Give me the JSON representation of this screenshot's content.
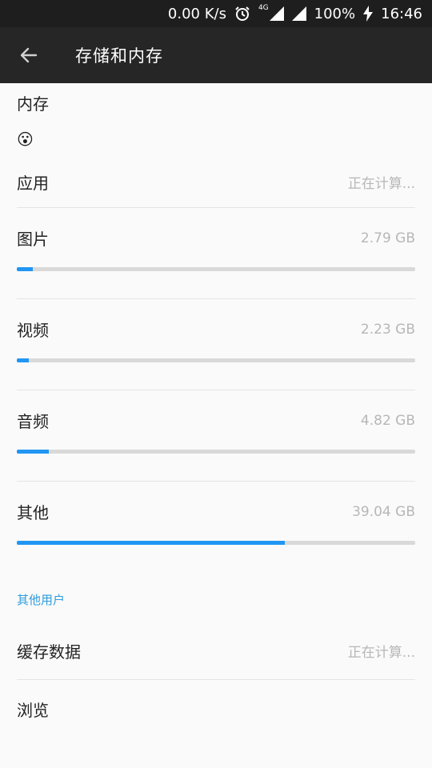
{
  "status": {
    "net_speed": "0.00 K/s",
    "alarm_icon": "alarm-icon",
    "network": "4G",
    "battery": "100%",
    "time": "16:46"
  },
  "appbar": {
    "title": "存储和内存"
  },
  "memory": {
    "section_title": "内存",
    "emoji": "😮"
  },
  "apps": {
    "label": "应用",
    "value": "正在计算..."
  },
  "categories": [
    {
      "label": "图片",
      "value": "2.79 GB",
      "fraction": 0.04
    },
    {
      "label": "视频",
      "value": "2.23 GB",
      "fraction": 0.03
    },
    {
      "label": "音频",
      "value": "4.82 GB",
      "fraction": 0.08
    },
    {
      "label": "其他",
      "value": "39.04 GB",
      "fraction": 0.672
    }
  ],
  "other_users": {
    "header": "其他用户"
  },
  "cache": {
    "label": "缓存数据",
    "value": "正在计算..."
  },
  "browse": {
    "label": "浏览"
  },
  "colors": {
    "accent": "#2196f3",
    "subheader": "#2e9cdb"
  }
}
